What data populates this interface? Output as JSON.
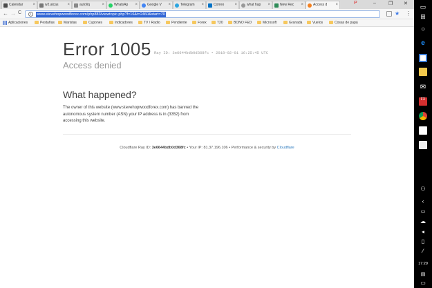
{
  "tabs": [
    {
      "label": "Calendar",
      "color": "#4a4a4a"
    },
    {
      "label": "w2.alcas",
      "color": "#777"
    },
    {
      "label": "autoliq",
      "color": "#888"
    },
    {
      "label": "WhatsAp",
      "color": "#25d366"
    },
    {
      "label": "Google V",
      "color": "#4285f4"
    },
    {
      "label": "Telegram",
      "color": "#2ca5e0"
    },
    {
      "label": "Correo",
      "color": "#0072c6"
    },
    {
      "label": "what hap",
      "color": "#999"
    },
    {
      "label": "New Rec",
      "color": "#2e8b57"
    },
    {
      "label": "Access d",
      "color": "#f48120"
    }
  ],
  "toolbar": {
    "back": "←",
    "forward": "→",
    "reload": "C",
    "url": "www.stevehopwoodforex.com/php883/viewtopic.php?f=16&t=2460&start=70",
    "star": "★",
    "menu": "⋮"
  },
  "bookmarks": [
    {
      "label": "Aplicaciones"
    },
    {
      "label": "Pestañas"
    },
    {
      "label": "Maristas"
    },
    {
      "label": "Cupones"
    },
    {
      "label": "Indicadores"
    },
    {
      "label": "TV / Radio"
    },
    {
      "label": "Pendiente"
    },
    {
      "label": "Forex"
    },
    {
      "label": "T20"
    },
    {
      "label": "BONO FED"
    },
    {
      "label": "Microsoft"
    },
    {
      "label": "Granada"
    },
    {
      "label": "Vuelos"
    },
    {
      "label": "Cosas de papá"
    }
  ],
  "page": {
    "error_code": "Error 1005",
    "ray_id_label": "Ray ID: 3e6644bdb0d368fc • 2018-02-01 16:25:45 UTC",
    "subtitle": "Access denied",
    "what_heading": "What happened?",
    "explanation": "The owner of this website (www.stevehopwoodforex.com) has banned the autonomous system number (ASN) your IP address is in (3352) from accessing this website.",
    "footer_ray_prefix": "Cloudflare Ray ID: ",
    "footer_ray_id": "3e6644bdb0d368fc",
    "footer_ip": " • Your IP: 81.37.196.106 • Performance & security by ",
    "footer_cf": "Cloudflare"
  },
  "window_controls": {
    "minimize": "–",
    "restore": "❐",
    "close": "✕"
  },
  "taskbar": {
    "time": "17:29"
  },
  "colors": {
    "accent": "#3367d6",
    "cloudflare": "#2f7bbf",
    "folder": "#f6c85f"
  }
}
